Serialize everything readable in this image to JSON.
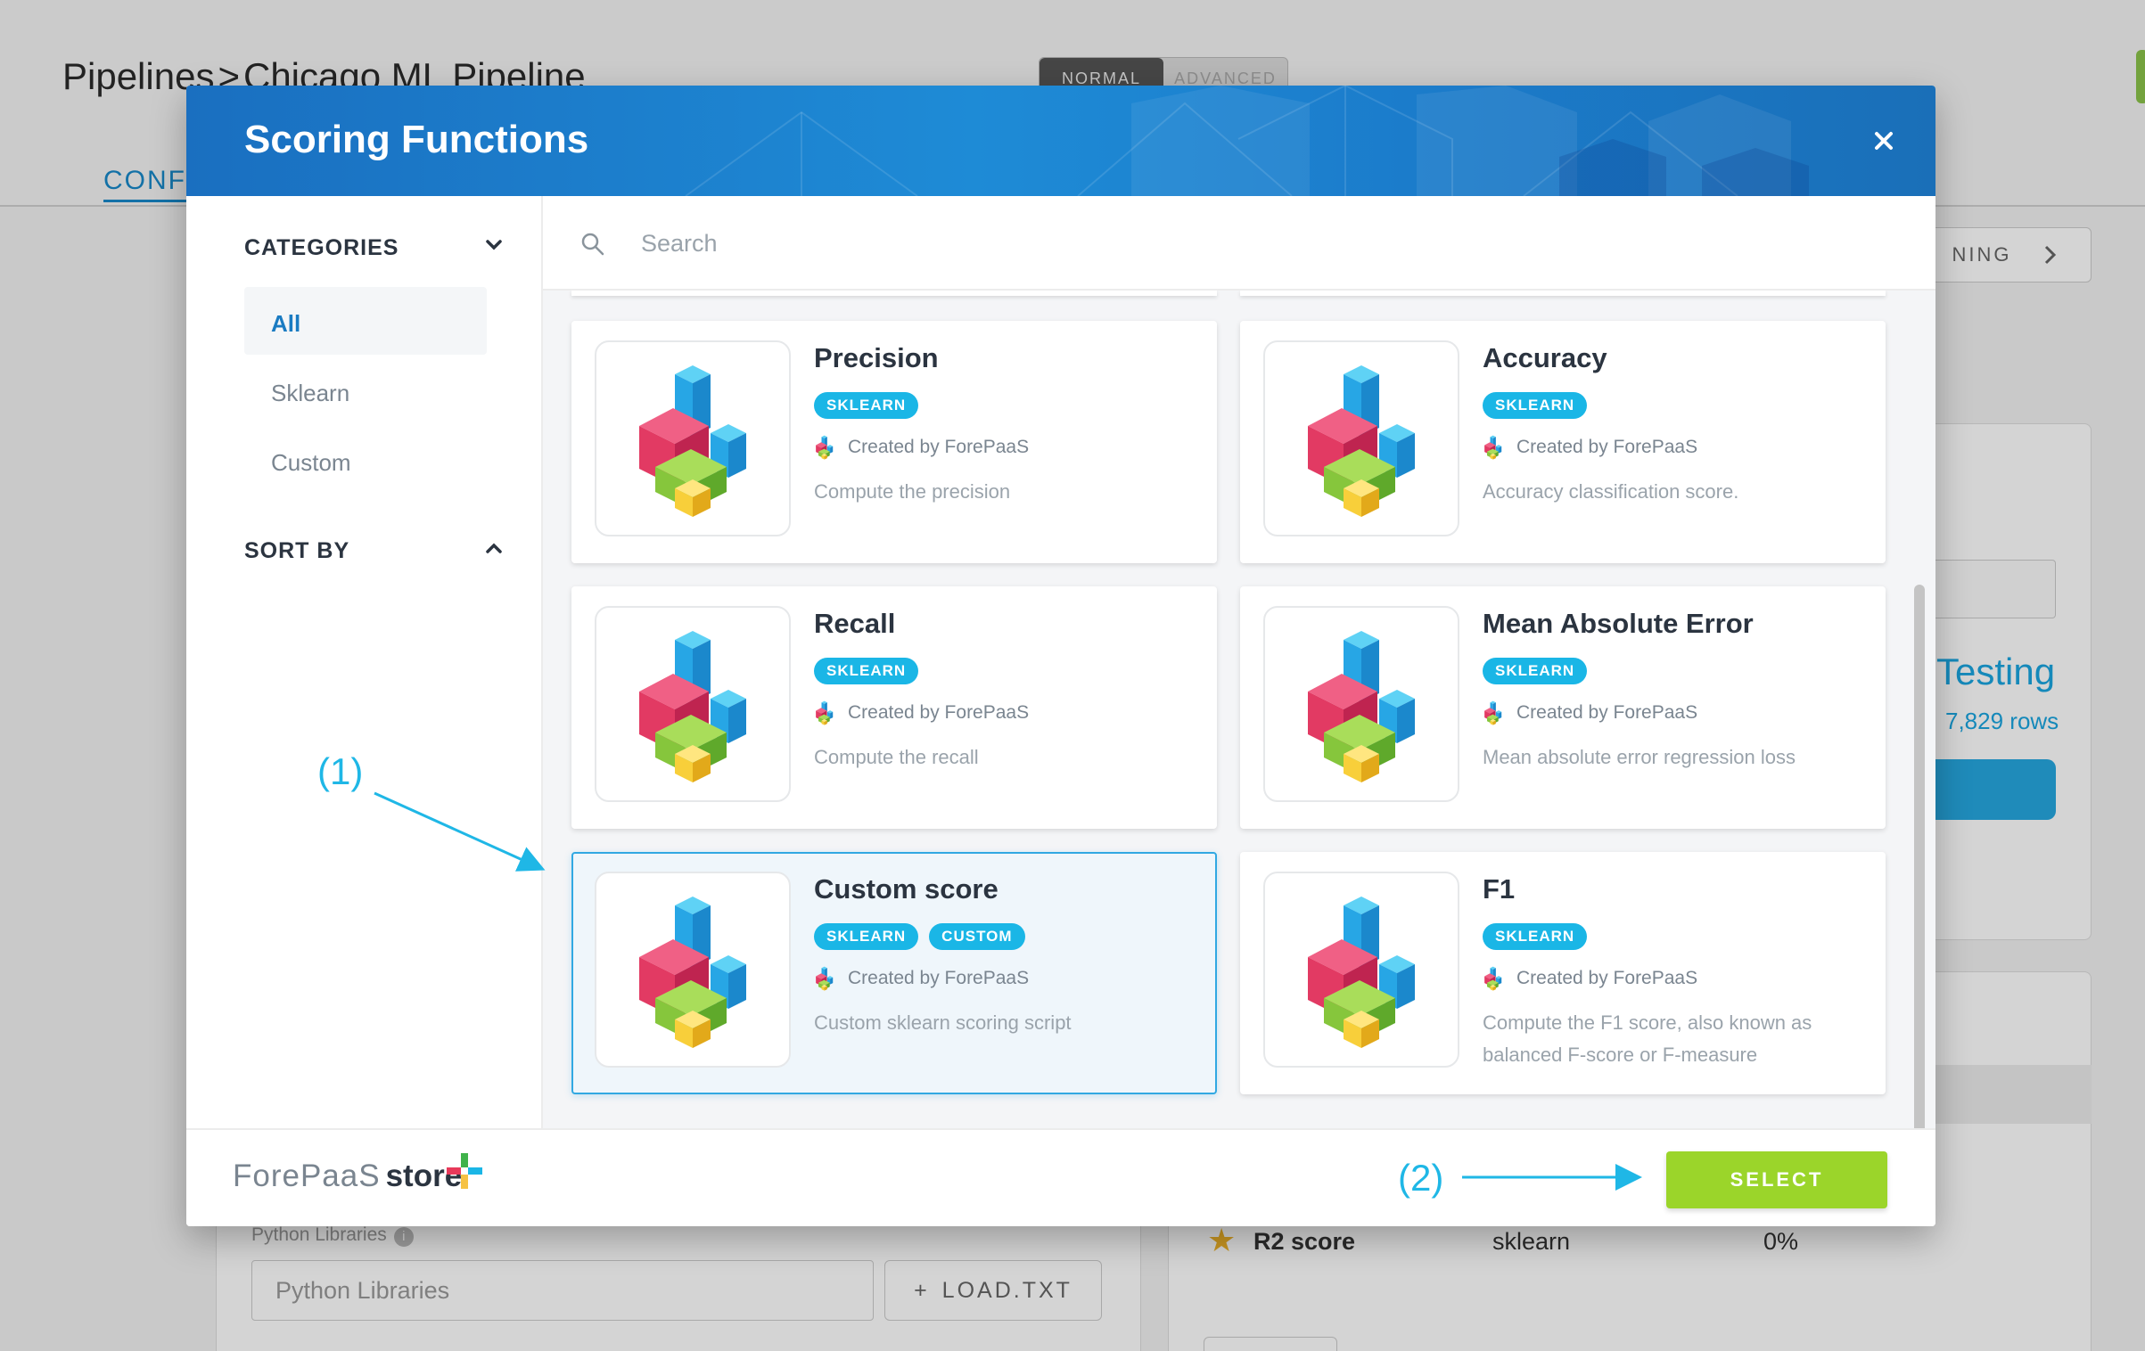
{
  "background": {
    "breadcrumb": {
      "root": "Pipelines",
      "separator": ">",
      "current": "Chicago ML Pipeline"
    },
    "mode_toggle": {
      "active": "NORMAL",
      "inactive": "ADVANCED"
    },
    "tab_label": "CONFI",
    "next_button_label": "NING",
    "testing": {
      "title": "Testing",
      "rows": "7,829 rows"
    },
    "metric_row": {
      "name": "R2 score",
      "library": "sklearn",
      "percent": "0%"
    },
    "python_libraries": {
      "label": "Python Libraries",
      "placeholder": "Python Libraries",
      "load_button": "LOAD.TXT",
      "load_icon": "+"
    }
  },
  "modal": {
    "title": "Scoring Functions",
    "close_icon": "×",
    "sidebar": {
      "categories_label": "CATEGORIES",
      "categories": [
        "All",
        "Sklearn",
        "Custom"
      ],
      "active_category": "All",
      "sort_label": "SORT BY"
    },
    "search": {
      "placeholder": "Search",
      "value": ""
    },
    "cards": [
      {
        "title": "Precision",
        "tags": [
          "SKLEARN"
        ],
        "creator": "Created by ForePaaS",
        "description": "Compute the precision",
        "selected": false
      },
      {
        "title": "Accuracy",
        "tags": [
          "SKLEARN"
        ],
        "creator": "Created by ForePaaS",
        "description": "Accuracy classification score.",
        "selected": false
      },
      {
        "title": "Recall",
        "tags": [
          "SKLEARN"
        ],
        "creator": "Created by ForePaaS",
        "description": "Compute the recall",
        "selected": false
      },
      {
        "title": "Mean Absolute Error",
        "tags": [
          "SKLEARN"
        ],
        "creator": "Created by ForePaaS",
        "description": "Mean absolute error regression loss",
        "selected": false
      },
      {
        "title": "Custom score",
        "tags": [
          "SKLEARN",
          "CUSTOM"
        ],
        "creator": "Created by ForePaaS",
        "description": "Custom sklearn scoring script",
        "selected": true
      },
      {
        "title": "F1",
        "tags": [
          "SKLEARN"
        ],
        "creator": "Created by ForePaaS",
        "description": "Compute the F1 score, also known as balanced F-score or F-measure",
        "selected": false
      }
    ],
    "footer": {
      "logo_brand": "ForePaaS",
      "logo_store": "store",
      "select_label": "SELECT"
    }
  },
  "annotations": {
    "first": "(1)",
    "second": "(2)"
  },
  "colors": {
    "accent_blue": "#1ab6e6",
    "header_blue": "#1e8bd6",
    "select_green": "#9bd52a",
    "selected_card_border": "#31a8e2",
    "annotation_cyan": "#1fb7e6"
  }
}
